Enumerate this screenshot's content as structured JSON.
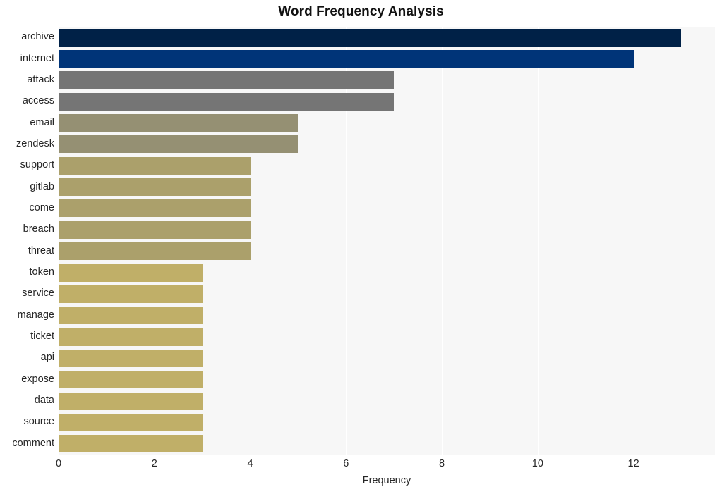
{
  "chart_data": {
    "type": "bar",
    "orientation": "horizontal",
    "title": "Word Frequency Analysis",
    "xlabel": "Frequency",
    "ylabel": "",
    "categories": [
      "archive",
      "internet",
      "attack",
      "access",
      "email",
      "zendesk",
      "support",
      "gitlab",
      "come",
      "breach",
      "threat",
      "token",
      "service",
      "manage",
      "ticket",
      "api",
      "expose",
      "data",
      "source",
      "comment"
    ],
    "values": [
      13,
      12,
      7,
      7,
      5,
      5,
      4,
      4,
      4,
      4,
      4,
      3,
      3,
      3,
      3,
      3,
      3,
      3,
      3,
      3
    ],
    "bar_colors": [
      "#002147",
      "#003478",
      "#757575",
      "#757575",
      "#959073",
      "#959073",
      "#aba06b",
      "#aba06b",
      "#aba06b",
      "#aba06b",
      "#aba06b",
      "#c0af68",
      "#c0af68",
      "#c0af68",
      "#c0af68",
      "#c0af68",
      "#c0af68",
      "#c0af68",
      "#c0af68",
      "#c0af68"
    ],
    "xlim": [
      0,
      13.7
    ],
    "xticks": [
      0,
      2,
      4,
      6,
      8,
      10,
      12
    ],
    "xtick_labels": [
      "0",
      "2",
      "4",
      "6",
      "8",
      "10",
      "12"
    ],
    "grid": {
      "vertical": true,
      "horizontal": false,
      "color": "#ffffff"
    },
    "plot_background": "#f7f7f7",
    "figure_background": "#ffffff",
    "legend": null,
    "annotations": []
  }
}
